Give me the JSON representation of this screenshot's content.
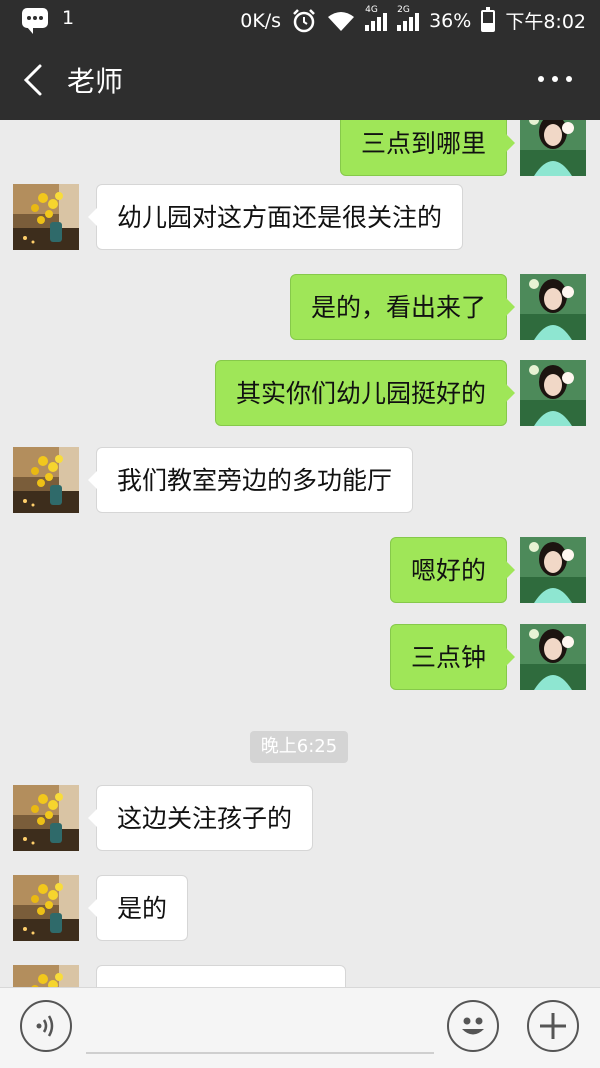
{
  "status_bar": {
    "notification_count": "1",
    "net_speed": "0K/s",
    "sim1_label": "4G",
    "sim2_label": "2G",
    "battery": "36%",
    "time": "下午8:02",
    "icons": [
      "message-icon",
      "alarm-icon",
      "wifi-icon",
      "signal-4g-icon",
      "signal-2g-icon",
      "battery-icon"
    ]
  },
  "header": {
    "title": "老师",
    "back_icon": "back-arrow-icon",
    "more_icon": "more-dots-icon"
  },
  "messages": [
    {
      "side": "out",
      "text": "三点到哪里"
    },
    {
      "side": "in",
      "text": "幼儿园对这方面还是很关注的"
    },
    {
      "side": "out",
      "text": "是的，看出来了"
    },
    {
      "side": "out",
      "text": "其实你们幼儿园挺好的"
    },
    {
      "side": "in",
      "text": "我们教室旁边的多功能厅"
    },
    {
      "side": "out",
      "text": "嗯好的"
    },
    {
      "side": "out",
      "text": "三点钟"
    },
    {
      "side": "in",
      "text": "这边关注孩子的"
    },
    {
      "side": "in",
      "text": "是的"
    },
    {
      "side": "in",
      "text": ""
    }
  ],
  "timestamp": "晚上6:25",
  "input_bar": {
    "voice_icon": "voice-icon",
    "emoji_icon": "emoji-icon",
    "plus_icon": "plus-icon",
    "text_value": ""
  },
  "colors": {
    "bar": "#2e2e2e",
    "chat_bg": "#ebebeb",
    "outgoing_bubble": "#9fe658",
    "incoming_bubble": "#ffffff"
  }
}
